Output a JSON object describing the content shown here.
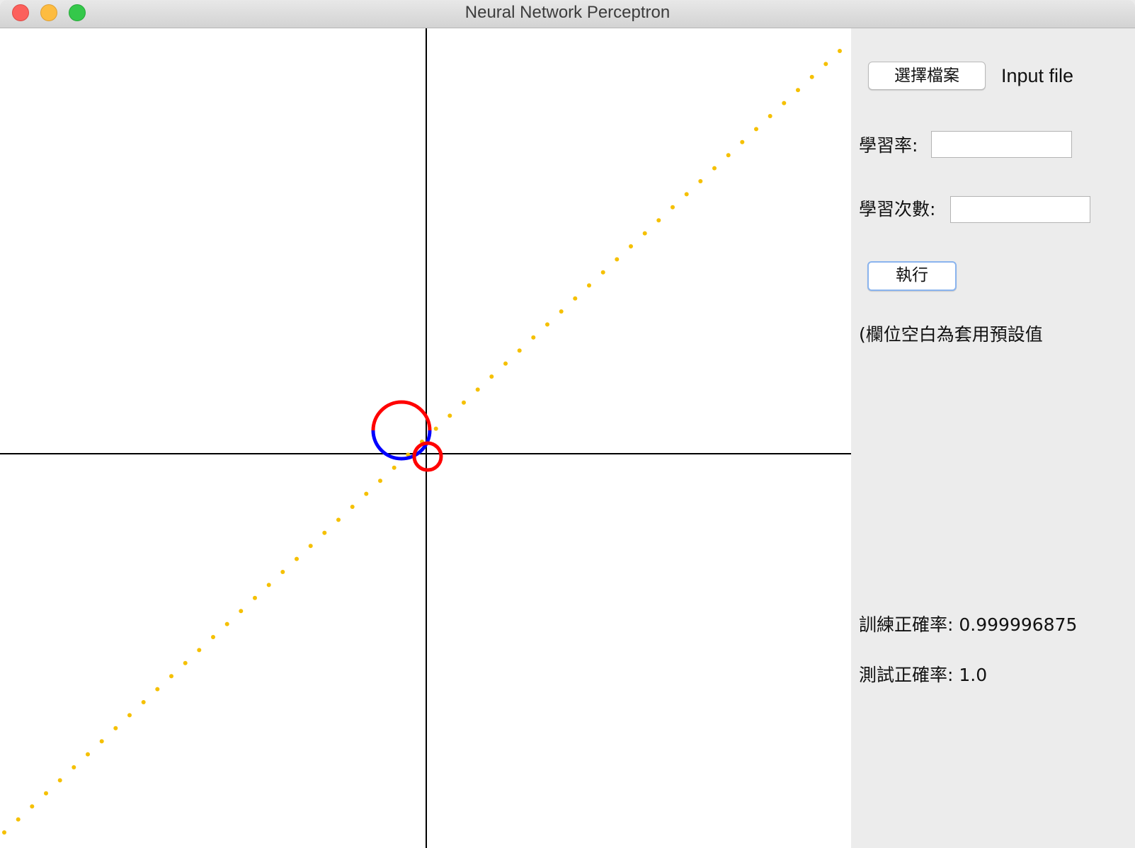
{
  "window": {
    "title": "Neural Network Perceptron"
  },
  "panel": {
    "choose_file_label": "選擇檔案",
    "input_file_label": "Input file",
    "learning_rate_label": "學習率:",
    "learning_rate_value": "",
    "epochs_label": "學習次數:",
    "epochs_value": "",
    "run_label": "執行",
    "default_note": "(欄位空白為套用預設值",
    "train_accuracy_label": "訓練正確率:",
    "train_accuracy_value": "0.999996875",
    "test_accuracy_label": "測試正確率:",
    "test_accuracy_value": "1.0"
  },
  "plot": {
    "axis_color": "#000000",
    "decision_line_color": "#f5c000",
    "class_a_color": "#ff0000",
    "class_b_color": "#0000ff"
  }
}
